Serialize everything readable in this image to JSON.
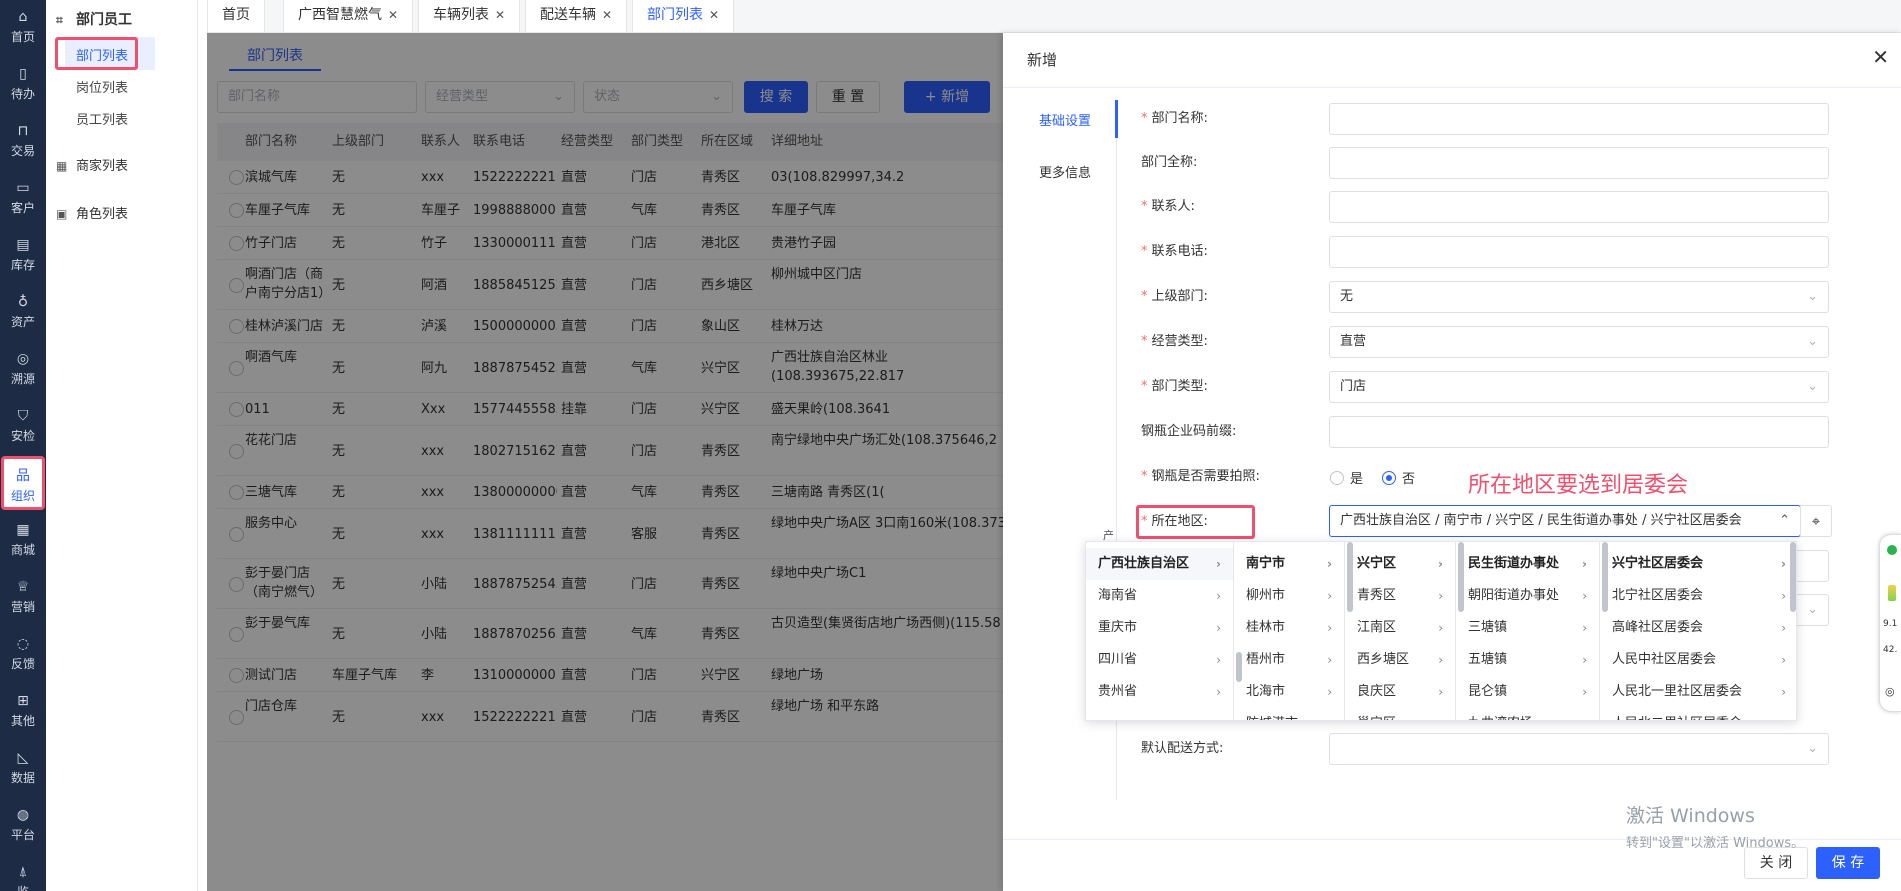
{
  "rail": [
    {
      "label": "首页",
      "icon": "home-icon",
      "glyph": "⌂"
    },
    {
      "label": "待办",
      "icon": "todo-icon",
      "glyph": "▯"
    },
    {
      "label": "交易",
      "icon": "bag-icon",
      "glyph": "⊓"
    },
    {
      "label": "客户",
      "icon": "id-card-icon",
      "glyph": "▭"
    },
    {
      "label": "库存",
      "icon": "inventory-icon",
      "glyph": "▤"
    },
    {
      "label": "资产",
      "icon": "bulb-icon",
      "glyph": "♁"
    },
    {
      "label": "溯源",
      "icon": "compass-icon",
      "glyph": "◎"
    },
    {
      "label": "安检",
      "icon": "shield-icon",
      "glyph": "⛉"
    },
    {
      "label": "组织",
      "icon": "org-icon",
      "glyph": "品"
    },
    {
      "label": "商城",
      "icon": "shop-icon",
      "glyph": "▦"
    },
    {
      "label": "营销",
      "icon": "trophy-icon",
      "glyph": "♕"
    },
    {
      "label": "反馈",
      "icon": "chat-icon",
      "glyph": "◌"
    },
    {
      "label": "其他",
      "icon": "blocks-icon",
      "glyph": "⊞"
    },
    {
      "label": "数据",
      "icon": "chart-icon",
      "glyph": "◺"
    },
    {
      "label": "平台",
      "icon": "platform-icon",
      "glyph": "◍"
    },
    {
      "label": "监",
      "icon": "alarm-icon",
      "glyph": "⍋"
    }
  ],
  "submenu": {
    "group1": "部门员工",
    "items": [
      "部门列表",
      "岗位列表",
      "员工列表"
    ],
    "group2": "商家列表",
    "group3": "角色列表"
  },
  "tabs": [
    "首页",
    "广西智慧燃气",
    "车辆列表",
    "配送车辆",
    "部门列表"
  ],
  "content": {
    "tab": "部门列表",
    "filters": {
      "name_placeholder": "部门名称",
      "type_placeholder": "经营类型",
      "status_placeholder": "状态"
    },
    "buttons": {
      "search": "搜 索",
      "reset": "重 置",
      "add": "+ 新增"
    },
    "columns": [
      "部门名称",
      "上级部门",
      "联系人",
      "联系电话",
      "经营类型",
      "部门类型",
      "所在区域",
      "详细地址"
    ],
    "rows": [
      [
        "滨城气库",
        "无",
        "xxx",
        "15222222211",
        "直营",
        "门店",
        "青秀区",
        "03(108.829997,34.2"
      ],
      [
        "车厘子气库",
        "无",
        "车厘子",
        "19988880001",
        "直营",
        "气库",
        "青秀区",
        "车厘子气库"
      ],
      [
        "竹子门店",
        "无",
        "竹子",
        "13300001111",
        "直营",
        "门店",
        "港北区",
        "贵港竹子园"
      ],
      [
        "啊酒门店（商户南宁分店1）",
        "无",
        "阿酒",
        "18858451252",
        "直营",
        "门店",
        "西乡塘区",
        "柳州城中区门店"
      ],
      [
        "桂林泸溪门店",
        "无",
        "泸溪",
        "15000000003",
        "直营",
        "门店",
        "象山区",
        "桂林万达"
      ],
      [
        "啊酒气库",
        "无",
        "阿九",
        "18878754525",
        "直营",
        "气库",
        "兴宁区",
        "广西壮族自治区林业(108.393675,22.817"
      ],
      [
        "011",
        "无",
        "Xxx",
        "15774455585",
        "挂靠",
        "门店",
        "兴宁区",
        "盛天果岭(108.3641"
      ],
      [
        "花花门店",
        "无",
        "xxx",
        "18027151627",
        "直营",
        "门店",
        "青秀区",
        "南宁绿地中央广场汇处(108.375646,2"
      ],
      [
        "三塘气库",
        "无",
        "xxx",
        "13800000000",
        "直营",
        "气库",
        "青秀区",
        "三塘南路 青秀区(1("
      ],
      [
        "服务中心",
        "无",
        "xxx",
        "13811111111",
        "直营",
        "客服",
        "青秀区",
        "绿地中央广场A区 3口南160米(108.373"
      ],
      [
        "彭于晏门店（南宁燃气）",
        "无",
        "小陆",
        "18878752545",
        "直营",
        "门店",
        "青秀区",
        "绿地中央广场C1"
      ],
      [
        "彭于晏气库",
        "无",
        "小陆",
        "18878702565",
        "直营",
        "气库",
        "青秀区",
        "古贝造型(集贤街店地广场西侧)(115.58"
      ],
      [
        "测试门店",
        "车厘子气库",
        "李",
        "13100000001",
        "直营",
        "门店",
        "兴宁区",
        "绿地广场"
      ],
      [
        "门店仓库",
        "无",
        "xxx",
        "15222222211",
        "直营",
        "门店",
        "青秀区",
        "绿地广场 和平东路"
      ]
    ]
  },
  "drawer": {
    "title": "新增",
    "nav": [
      "基础设置",
      "更多信息"
    ],
    "labels": {
      "name": "部门名称:",
      "fullname": "部门全称:",
      "contact": "联系人:",
      "phone": "联系电话:",
      "parent": "上级部门:",
      "biztype": "经营类型:",
      "depttype": "部门类型:",
      "prefix": "钢瓶企业码前缀:",
      "photo": "钢瓶是否需要拍照:",
      "region": "所在地区:",
      "delivery": "默认配送方式:",
      "obscured": "产"
    },
    "values": {
      "parent": "无",
      "biztype": "直营",
      "depttype": "门店",
      "region": "广西壮族自治区 / 南宁市 / 兴宁区 / 民生街道办事处 / 兴宁社区居委会"
    },
    "photo_options": [
      "是",
      "否"
    ],
    "annotation": "所在地区要选到居委会",
    "footer": {
      "close": "关 闭",
      "save": "保 存"
    }
  },
  "cascader": {
    "col1": [
      "广西壮族自治区",
      "海南省",
      "重庆市",
      "四川省",
      "贵州省"
    ],
    "col2": [
      "南宁市",
      "柳州市",
      "桂林市",
      "梧州市",
      "北海市",
      "防城港市"
    ],
    "col3": [
      "兴宁区",
      "青秀区",
      "江南区",
      "西乡塘区",
      "良庆区",
      "邕宁区"
    ],
    "col4": [
      "民生街道办事处",
      "朝阳街道办事处",
      "三塘镇",
      "五塘镇",
      "昆仑镇",
      "九曲湾农场"
    ],
    "col5": [
      "兴宁社区居委会",
      "北宁社区居委会",
      "高峰社区居委会",
      "人民中社区居委会",
      "人民北一里社区居委会",
      "人民北二里社区居委会"
    ]
  },
  "watermark": {
    "line1": "激活 Windows",
    "line2": "转到\"设置\"以激活 Windows。"
  },
  "float_panel": {
    "t1": "9.1",
    "t2": "42."
  }
}
